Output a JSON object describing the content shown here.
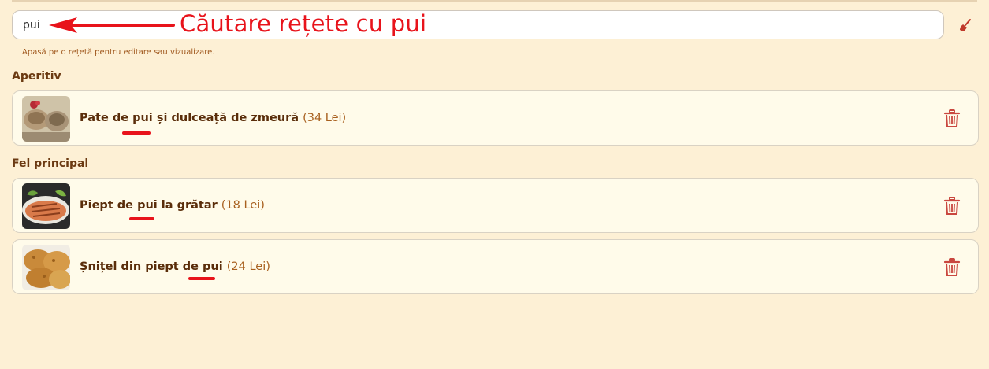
{
  "search": {
    "value": "pui",
    "placeholder": ""
  },
  "annotation": {
    "text": "Căutare rețete cu pui",
    "color": "#e8131b"
  },
  "hint": "Apasă pe o rețetă pentru editare sau vizualizare.",
  "icons": {
    "clear": "broom-icon",
    "delete": "trash-icon",
    "arrow": "left-arrow-annotation"
  },
  "colors": {
    "background": "#fdf0d5",
    "card": "#fffbea",
    "title": "#5a2d0a",
    "price": "#a8601f",
    "delete": "#c9473f",
    "highlight": "#e8131b"
  },
  "sections": [
    {
      "title": "Aperitiv",
      "recipes": [
        {
          "name_before": "Pate de ",
          "name_match": "pui",
          "name_after": " și dulceață de zmeură",
          "price": "(34 Lei)"
        }
      ]
    },
    {
      "title": "Fel principal",
      "recipes": [
        {
          "name_before": "Piept de ",
          "name_match": "pui",
          "name_after": " la grătar",
          "price": "(18 Lei)"
        },
        {
          "name_before": "Șnițel din piept de ",
          "name_match": "pui",
          "name_after": "",
          "price": "(24 Lei)"
        }
      ]
    }
  ]
}
